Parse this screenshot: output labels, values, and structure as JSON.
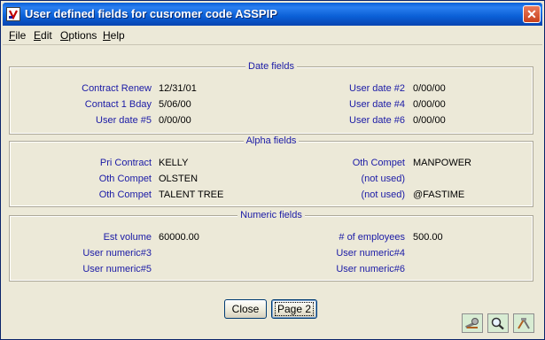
{
  "window": {
    "title": "User defined fields for cusromer code ASSPIP",
    "close_glyph": "✕"
  },
  "menu": [
    {
      "label": "File",
      "underline": "F",
      "rest": "ile"
    },
    {
      "label": "Edit",
      "underline": "E",
      "rest": "dit"
    },
    {
      "label": "Options",
      "underline": "O",
      "rest": "ptions"
    },
    {
      "label": "Help",
      "underline": "H",
      "rest": "elp"
    }
  ],
  "date_group": {
    "title": "Date fields",
    "left": [
      {
        "label": "Contract Renew",
        "value": "12/31/01"
      },
      {
        "label": "Contact 1 Bday",
        "value": "5/06/00"
      },
      {
        "label": "User date #5",
        "value": "0/00/00"
      }
    ],
    "right": [
      {
        "label": "User date #2",
        "value": "0/00/00"
      },
      {
        "label": "User date #4",
        "value": "0/00/00"
      },
      {
        "label": "User date #6",
        "value": "0/00/00"
      }
    ]
  },
  "alpha_group": {
    "title": "Alpha fields",
    "left": [
      {
        "label": "Pri Contract",
        "value": "KELLY"
      },
      {
        "label": "Oth Compet",
        "value": "OLSTEN"
      },
      {
        "label": "Oth Compet",
        "value": "TALENT TREE"
      }
    ],
    "right": [
      {
        "label": "Oth Compet",
        "value": "MANPOWER"
      },
      {
        "label": "(not used)",
        "value": ""
      },
      {
        "label": "(not used)",
        "value": "@FASTIME"
      }
    ]
  },
  "numeric_group": {
    "title": "Numeric fields",
    "left": [
      {
        "label": "Est volume",
        "value": "60000.00"
      },
      {
        "label": "User numeric#3",
        "value": ""
      },
      {
        "label": "User numeric#5",
        "value": ""
      }
    ],
    "right": [
      {
        "label": "# of employees",
        "value": "500.00"
      },
      {
        "label": "User numeric#4",
        "value": ""
      },
      {
        "label": "User numeric#6",
        "value": ""
      }
    ]
  },
  "buttons": {
    "close": "Close",
    "page2": "Page 2"
  },
  "toolbar_icons": [
    "wrench-icon",
    "magnify-icon",
    "tools-icon"
  ]
}
